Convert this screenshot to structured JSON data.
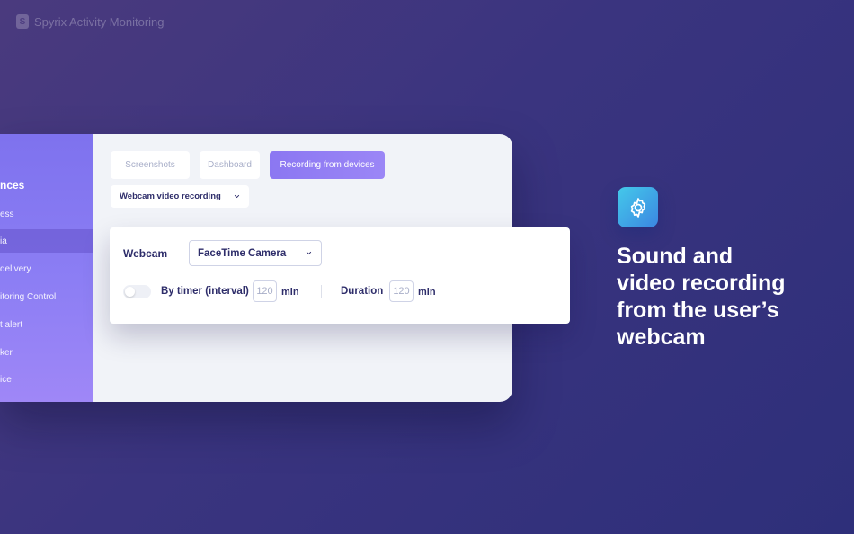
{
  "brand": {
    "name": "Spyrix Activity Monitoring",
    "logo_letter": "S"
  },
  "sidebar": {
    "title": "nces",
    "items": [
      {
        "label": "ess",
        "active": false
      },
      {
        "label": "ia",
        "active": true
      },
      {
        "label": "delivery",
        "active": false
      },
      {
        "label": "itoring Control",
        "active": false
      },
      {
        "label": "t alert",
        "active": false
      },
      {
        "label": "ker",
        "active": false
      },
      {
        "label": "ice",
        "active": false
      }
    ]
  },
  "tabs": [
    {
      "label": "Screenshots",
      "active": false
    },
    {
      "label": "Dashboard",
      "active": false
    },
    {
      "label": "Recording from devices",
      "active": true
    }
  ],
  "recording_type_select": {
    "value": "Webcam video recording",
    "icon": "chevron-down-icon"
  },
  "webcam_card": {
    "webcam_label": "Webcam",
    "camera_select": {
      "value": "FaceTime Camera",
      "icon": "chevron-down-icon"
    },
    "timer_toggle": {
      "on": false
    },
    "timer_label": "By timer (interval)",
    "timer_value": "120",
    "timer_unit": "min",
    "duration_label": "Duration",
    "duration_value": "120",
    "duration_unit": "min"
  },
  "feature": {
    "icon": "gear-icon",
    "headline_lines": [
      "Sound and",
      "video recording",
      "from the user’s",
      "webcam"
    ]
  },
  "colors": {
    "accent_purple": "#8b77f2",
    "text_dark": "#2e2d6a",
    "gear_gradient_start": "#44c9ea",
    "gear_gradient_end": "#3b86e2"
  }
}
